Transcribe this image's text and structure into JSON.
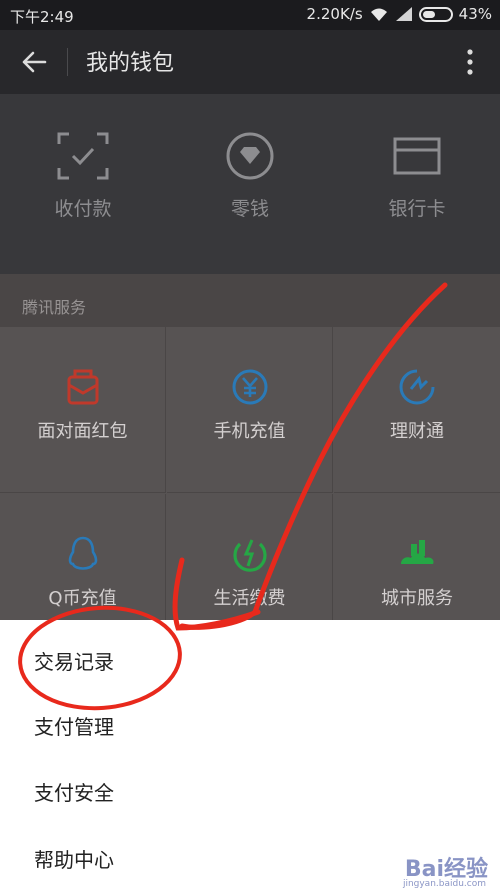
{
  "status_bar": {
    "time": "下午2:49",
    "speed": "2.20K/s",
    "battery": "43%"
  },
  "header": {
    "title": "我的钱包"
  },
  "top_actions": [
    {
      "label": "收付款",
      "icon": "scan-qr-icon"
    },
    {
      "label": "零钱",
      "icon": "change-wallet-icon"
    },
    {
      "label": "银行卡",
      "icon": "bank-card-icon"
    }
  ],
  "services": {
    "section_title": "腾讯服务",
    "items": [
      {
        "label": "面对面红包",
        "icon": "red-packet-icon",
        "color": "#c0392b"
      },
      {
        "label": "手机充值",
        "icon": "yuan-coin-icon",
        "color": "#2a7ab8"
      },
      {
        "label": "理财通",
        "icon": "licaitong-icon",
        "color": "#2a7ab8"
      },
      {
        "label": "Q币充值",
        "icon": "qq-penguin-icon",
        "color": "#2a7ab8"
      },
      {
        "label": "生活缴费",
        "icon": "life-payment-icon",
        "color": "#25a745"
      },
      {
        "label": "城市服务",
        "icon": "city-service-icon",
        "color": "#25a745"
      }
    ]
  },
  "menu": {
    "items": [
      "交易记录",
      "支付管理",
      "支付安全",
      "帮助中心"
    ]
  },
  "watermark": {
    "text": "Bai经验",
    "sub": "jingyan.baidu.com"
  },
  "annotation_color": "#e8291c"
}
